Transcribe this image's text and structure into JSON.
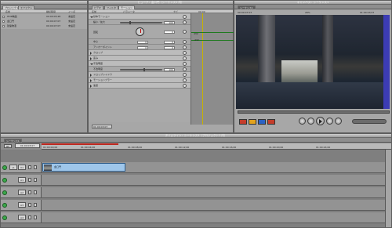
{
  "browser": {
    "tabs": [
      {
        "label": "プロジェクト"
      },
      {
        "label": "エフェクト"
      }
    ],
    "columns": {
      "name": "名前",
      "duration": "継続時間",
      "in": "イン点"
    },
    "items": [
      {
        "name": "HDR映画",
        "duration": "00:00:05;28",
        "in": "未設定"
      },
      {
        "name": "金口門",
        "duration": "00:00:07:07",
        "in": "未設定"
      },
      {
        "name": "建築物液",
        "duration": "00:00:07:07",
        "in": "未設定"
      }
    ]
  },
  "viewer": {
    "window_title": "ビューア：金口門（シーケンス1 内）",
    "tabs": [
      {
        "label": "ビデオ"
      },
      {
        "label": "フィルタ"
      },
      {
        "label": "モーション"
      }
    ],
    "columns": {
      "name": "名前",
      "params": "パラメータ",
      "nav": "ナビ"
    },
    "ruler_time": "00:00",
    "rows": [
      {
        "label": "基本モーション",
        "kind": "section"
      },
      {
        "label": "縮小／拡大",
        "value": "100"
      },
      {
        "label": "回転",
        "value": "0"
      },
      {
        "label": "中心",
        "value": "0",
        "value2": "0"
      },
      {
        "label": "アンカーポイント",
        "value": "0",
        "value2": "0"
      },
      {
        "label": "クロップ",
        "kind": "section"
      },
      {
        "label": "歪み",
        "kind": "section"
      },
      {
        "label": "不透明度",
        "kind": "section"
      },
      {
        "label": "不透明度",
        "value": "100"
      },
      {
        "label": "ドロップシャドウ",
        "kind": "section"
      },
      {
        "label": "モーションブラー",
        "kind": "section"
      },
      {
        "label": "速度",
        "kind": "section"
      }
    ],
    "nav_values": [
      "432",
      "-432"
    ],
    "timecode": "01:00:03;07"
  },
  "canvas": {
    "window_title": "キャンバス：シーケンス1",
    "tab": "シーケンス1",
    "timecode_left": "00:00:07:07",
    "timecode_right": "01:00:03;07",
    "zoom": "28%",
    "buttons": [
      "play-in-to-out",
      "play-around",
      "previous-edit",
      "play",
      "next-edit"
    ]
  },
  "timeline": {
    "window_title": "タイムライン：シーケンス1（プロジェクト1 内）",
    "tab": "シーケンス1",
    "rt_label": "RT",
    "current_time": "01:00:03:07",
    "ruler_labels": [
      "01:00:00;00",
      "01:00:04;00",
      "01:00:08;00",
      "01:00:12;00",
      "01:00:16;00",
      "01:00:20;00",
      "01:00:24;00"
    ],
    "tracks": [
      {
        "name": "V1",
        "source": "v1",
        "type": "video"
      },
      {
        "name": "A1",
        "source": "a1",
        "type": "audio"
      },
      {
        "name": "A2",
        "source": "a2",
        "type": "audio"
      },
      {
        "name": "A3",
        "source": "a3",
        "type": "audio"
      },
      {
        "name": "A4",
        "source": "a4",
        "type": "audio"
      }
    ],
    "clip": {
      "name": "金口門",
      "color": "#9ec6ea"
    },
    "progress": {
      "render_fill": 0.22
    }
  }
}
